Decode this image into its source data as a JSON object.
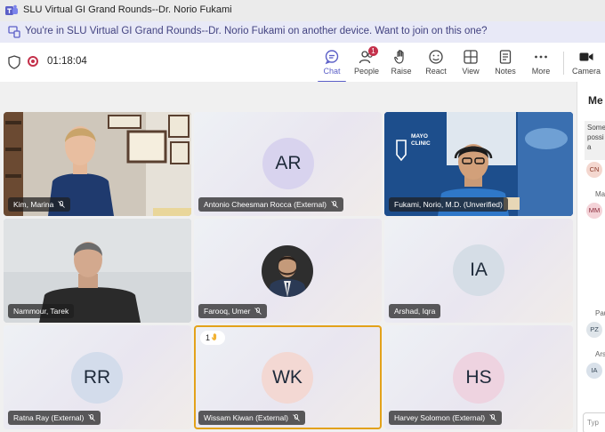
{
  "window": {
    "title": "SLU Virtual GI Grand Rounds--Dr. Norio Fukami"
  },
  "banner": {
    "text": "You're in SLU Virtual GI Grand Rounds--Dr. Norio Fukami on another device. Want to join on this one?"
  },
  "toolbar": {
    "timer": "01:18:04",
    "buttons": [
      {
        "label": "Chat",
        "icon": "chat-icon"
      },
      {
        "label": "People",
        "icon": "people-icon",
        "badge": "1"
      },
      {
        "label": "Raise",
        "icon": "hand-icon"
      },
      {
        "label": "React",
        "icon": "smiley-icon"
      },
      {
        "label": "View",
        "icon": "grid-icon"
      },
      {
        "label": "Notes",
        "icon": "notes-icon"
      },
      {
        "label": "More",
        "icon": "more-icon"
      },
      {
        "label": "Camera",
        "icon": "camera-icon"
      }
    ]
  },
  "participants": [
    {
      "name": "Kim, Marina",
      "type": "video",
      "bg": "#8a7a6a"
    },
    {
      "name": "Antonio Cheesman Rocca (External)",
      "initials": "AR",
      "avatar_color": "#d8d3ee"
    },
    {
      "name": "Fukami, Norio, M.D. (Unverified)",
      "type": "video",
      "speaking": true,
      "bg": "#1f4f8f",
      "logo_text": "MAYO CLINIC"
    },
    {
      "name": "Nammour, Tarek",
      "type": "video",
      "bg": "#cfd3d6"
    },
    {
      "name": "Farooq, Umer",
      "type": "photo"
    },
    {
      "name": "Arshad, Iqra",
      "initials": "IA",
      "avatar_color": "#d5dde6"
    },
    {
      "name": "Ratna Ray (External)",
      "initials": "RR",
      "avatar_color": "#d3dceb"
    },
    {
      "name": "Wissam Kiwan (External)",
      "initials": "WK",
      "avatar_color": "#f3d8d3",
      "hand_raised": true,
      "hand_badge": "1"
    },
    {
      "name": "Harvey Solomon (External)",
      "initials": "HS",
      "avatar_color": "#eed3e0"
    }
  ],
  "side_panel": {
    "title": "Me",
    "note_text": "Some possi will a",
    "avatars": [
      {
        "initials": "CN",
        "color": "#f4d7cf"
      },
      {
        "initials": "MM",
        "color": "#f4d3d8"
      },
      {
        "initials": "PZ",
        "color": "#dfe5ea"
      },
      {
        "initials": "IA",
        "color": "#d9e1ea"
      }
    ],
    "stubs": [
      "Ma",
      "Pau",
      "Ars"
    ],
    "typebox": "Typ"
  },
  "colors": {
    "accent": "#5b5fc7",
    "record": "#c4314b",
    "hand_raise": "#e3a21a"
  }
}
